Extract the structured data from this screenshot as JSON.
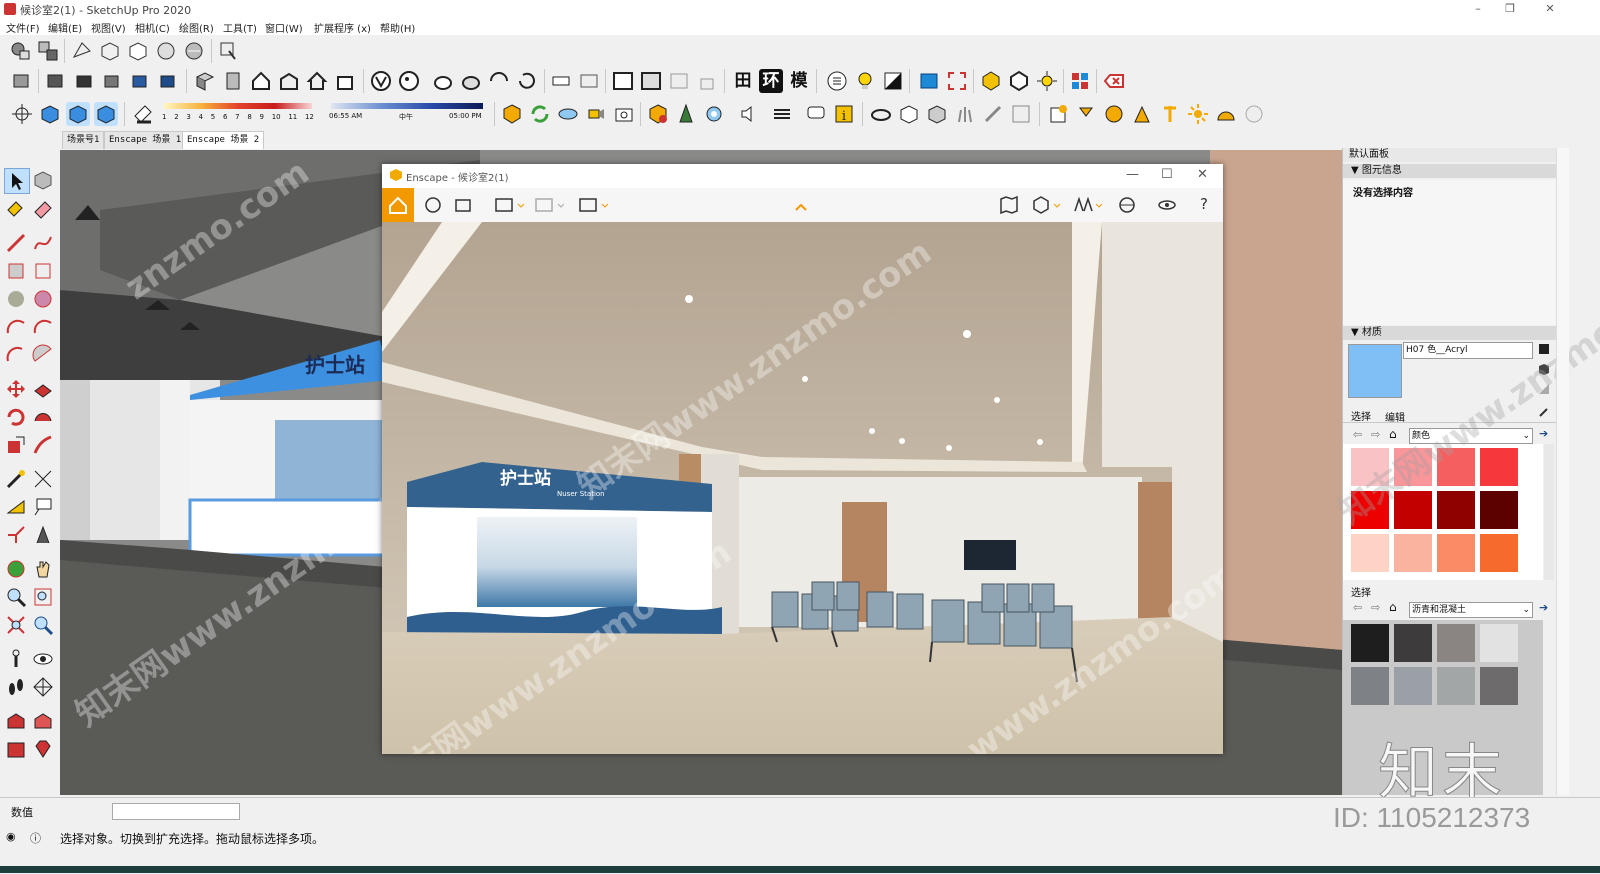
{
  "window": {
    "title": "候诊室2(1) - SketchUp Pro 2020",
    "controls": [
      "–",
      "❐",
      "✕"
    ]
  },
  "menu": [
    "文件(F)",
    "编辑(E)",
    "视图(V)",
    "相机(C)",
    "绘图(R)",
    "工具(T)",
    "窗口(W)",
    "扩展程序 (x)",
    "帮助(H)"
  ],
  "toolbar": {
    "shadow_scale_labels": [
      "1",
      "2",
      "3",
      "4",
      "5",
      "6",
      "7",
      "8",
      "9",
      "10",
      "11",
      "12"
    ],
    "time_start": "06:55 AM",
    "time_mid": "中午",
    "time_end": "05:00 PM",
    "text_icons": [
      "田",
      "环",
      "模"
    ]
  },
  "scenes": [
    "场景号1",
    "Enscape 场景 1",
    "Enscape 场景 2"
  ],
  "enscape": {
    "title": "Enscape - 候诊室2(1)",
    "help_label": "?"
  },
  "viewport_sign": "护士站",
  "render": {
    "sign_main": "护士站",
    "sign_sub": "Nuser Station"
  },
  "right_panel": {
    "header": "默认面板",
    "entity_info": {
      "title": "图元信息",
      "empty_text": "没有选择内容"
    },
    "materials": {
      "title": "材质",
      "material_name": "H07 色__Acryl",
      "preview_color": "#7fbff5",
      "tab_select": "选择",
      "tab_edit": "编辑",
      "library": "颜色",
      "colors": [
        "#f9c2c5",
        "#f8969a",
        "#f65f60",
        "#f4383b",
        "#ec0000",
        "#c20000",
        "#8f0000",
        "#5c0000",
        "#fcd3c5",
        "#fab39f",
        "#f98c66",
        "#f66a2e"
      ]
    },
    "select2": {
      "title": "选择",
      "library": "沥青和混凝土",
      "textures": [
        "#c9c9c9",
        "#1e1e1e",
        "#3d3b3b",
        "#8a8583",
        "#e2e2e2",
        "#7e8186",
        "#9aa0a5",
        "#a2a6a6",
        "#6d6b6b"
      ]
    }
  },
  "watermarks": [
    "znzmo.com",
    "知末网www.znzmo.com",
    "知末网www.znzmo.com",
    "知末网www.znzmo.com",
    "www.znzmo.com",
    "知末网www.znzmo.com"
  ],
  "logo_text": "知末",
  "id_text": "ID: 1105212373",
  "status": {
    "measure_label": "数值",
    "measure_value": "",
    "hint": "选择对象。切换到扩充选择。拖动鼠标选择多项。"
  }
}
